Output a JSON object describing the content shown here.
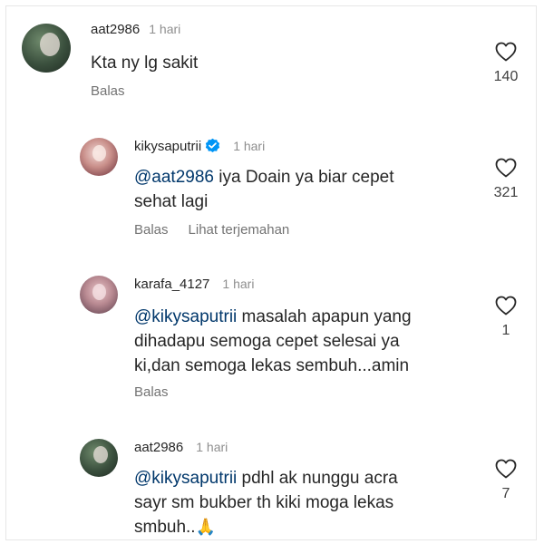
{
  "comments": [
    {
      "username": "aat2986",
      "time": "1 hari",
      "text": "Kta ny lg sakit",
      "actions": [
        "Balas"
      ],
      "like_count": "140",
      "avatar_icon": "profile-photo"
    },
    {
      "username": "kikysaputrii",
      "verified": true,
      "time": "1 hari",
      "mention": "@aat2986",
      "text_line1": " iya Doain ya biar cepet",
      "text_line2": "sehat lagi",
      "actions": [
        "Balas",
        "Lihat terjemahan"
      ],
      "like_count": "321",
      "avatar_icon": "profile-photo"
    },
    {
      "username": "karafa_4127",
      "time": "1 hari",
      "mention": "@kikysaputrii",
      "text_line1": " masalah apapun yang",
      "text_line2": "dihadapu semoga cepet selesai ya",
      "text_line3": "ki,dan semoga lekas sembuh...amin",
      "actions": [
        "Balas"
      ],
      "like_count": "1",
      "avatar_icon": "profile-photo"
    },
    {
      "username": "aat2986",
      "time": "1 hari",
      "mention": "@kikysaputrii",
      "text_line1": " pdhl ak nunggu acra",
      "text_line2": "sayr sm bukber th kiki moga lekas",
      "text_line3": "smbuh..",
      "emoji": "🙏",
      "like_count": "7",
      "avatar_icon": "profile-photo"
    }
  ],
  "colors": {
    "mention": "#00376b",
    "verified": "#0095f6",
    "secondary_text": "#8e8e8e"
  }
}
